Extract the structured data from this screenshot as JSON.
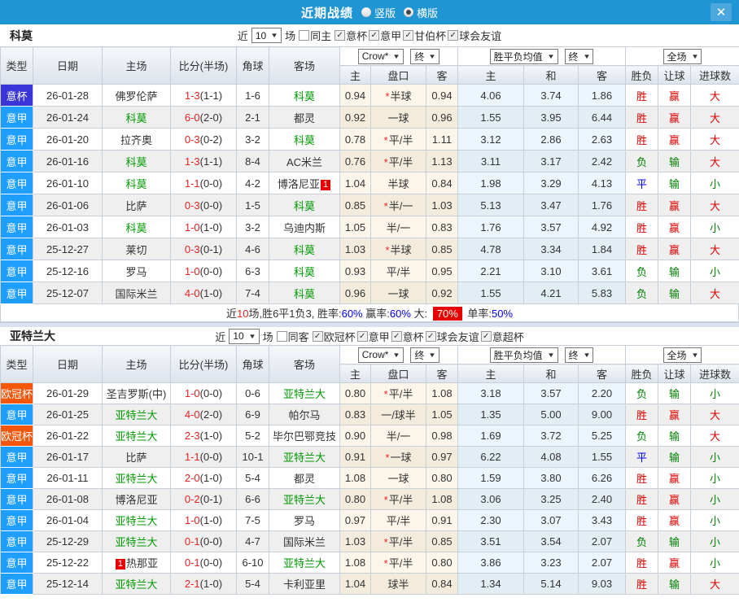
{
  "icons": {
    "close": "✕",
    "dropdown_arrow": "▼",
    "check": "✓"
  },
  "colors": {
    "topbar": "#2095D4",
    "league": {
      "意甲": "#1E9FFF",
      "意杯": "#3935D8",
      "欧冠杯": "#F4560A"
    },
    "result": {
      "胜": "#E00000",
      "平": "#0000E0",
      "负": "#008000",
      "赢": "#E00000",
      "输": "#008000",
      "大": "#E00000",
      "小": "#008000"
    }
  },
  "titlebar": {
    "title": "近期战绩",
    "radio_vertical": "竖版",
    "radio_horizontal": "横版",
    "selected_mode": "横版"
  },
  "table_header": {
    "type": "类型",
    "date": "日期",
    "home": "主场",
    "score": "比分(半场)",
    "corner": "角球",
    "away": "客场",
    "sub": [
      "主",
      "盘口",
      "客",
      "主",
      "和",
      "客",
      "胜负",
      "让球",
      "进球数"
    ],
    "select_company": "Crow*",
    "select_final1": "终",
    "select_avg": "胜平负均值",
    "select_final2": "终",
    "select_scope": "全场"
  },
  "sections": [
    {
      "team": "科莫",
      "filters": {
        "near": "近",
        "count": "10",
        "games": "场",
        "same": "同主",
        "same_checked": false,
        "leagues": [
          {
            "label": "意杯",
            "checked": true
          },
          {
            "label": "意甲",
            "checked": true
          },
          {
            "label": "甘伯杯",
            "checked": true
          },
          {
            "label": "球会友谊",
            "checked": true
          }
        ]
      },
      "rows": [
        {
          "league": "意杯",
          "date": "26-01-28",
          "home": {
            "name": "佛罗伦萨"
          },
          "ft": "1-3",
          "ht": "(1-1)",
          "corner": "1-6",
          "away": {
            "name": "科莫",
            "focus": true
          },
          "h1": "0.94",
          "star": true,
          "hcp": "半球",
          "h2": "0.94",
          "e1": "4.06",
          "e2": "3.74",
          "e3": "1.86",
          "r1": "胜",
          "r2": "赢",
          "r3": "大"
        },
        {
          "league": "意甲",
          "date": "26-01-24",
          "home": {
            "name": "科莫",
            "focus": true
          },
          "ft": "6-0",
          "ht": "(2-0)",
          "corner": "2-1",
          "away": {
            "name": "都灵"
          },
          "h1": "0.92",
          "star": false,
          "hcp": "一球",
          "h2": "0.96",
          "e1": "1.55",
          "e2": "3.95",
          "e3": "6.44",
          "r1": "胜",
          "r2": "赢",
          "r3": "大"
        },
        {
          "league": "意甲",
          "date": "26-01-20",
          "home": {
            "name": "拉齐奥"
          },
          "ft": "0-3",
          "ht": "(0-2)",
          "corner": "3-2",
          "away": {
            "name": "科莫",
            "focus": true
          },
          "h1": "0.78",
          "star": true,
          "hcp": "平/半",
          "h2": "1.11",
          "e1": "3.12",
          "e2": "2.86",
          "e3": "2.63",
          "r1": "胜",
          "r2": "赢",
          "r3": "大"
        },
        {
          "league": "意甲",
          "date": "26-01-16",
          "home": {
            "name": "科莫",
            "focus": true
          },
          "ft": "1-3",
          "ht": "(1-1)",
          "corner": "8-4",
          "away": {
            "name": "AC米兰"
          },
          "h1": "0.76",
          "star": true,
          "hcp": "平/半",
          "h2": "1.13",
          "e1": "3.11",
          "e2": "3.17",
          "e3": "2.42",
          "r1": "负",
          "r2": "输",
          "r3": "大"
        },
        {
          "league": "意甲",
          "date": "26-01-10",
          "home": {
            "name": "科莫",
            "focus": true
          },
          "ft": "1-1",
          "ht": "(0-0)",
          "corner": "4-2",
          "away": {
            "name": "博洛尼亚",
            "card_after": "1"
          },
          "h1": "1.04",
          "star": false,
          "hcp": "半球",
          "h2": "0.84",
          "e1": "1.98",
          "e2": "3.29",
          "e3": "4.13",
          "r1": "平",
          "r2": "输",
          "r3": "小"
        },
        {
          "league": "意甲",
          "date": "26-01-06",
          "home": {
            "name": "比萨"
          },
          "ft": "0-3",
          "ht": "(0-0)",
          "corner": "1-5",
          "away": {
            "name": "科莫",
            "focus": true
          },
          "h1": "0.85",
          "star": true,
          "hcp": "半/一",
          "h2": "1.03",
          "e1": "5.13",
          "e2": "3.47",
          "e3": "1.76",
          "r1": "胜",
          "r2": "赢",
          "r3": "大"
        },
        {
          "league": "意甲",
          "date": "26-01-03",
          "home": {
            "name": "科莫",
            "focus": true
          },
          "ft": "1-0",
          "ht": "(1-0)",
          "corner": "3-2",
          "away": {
            "name": "乌迪内斯"
          },
          "h1": "1.05",
          "star": false,
          "hcp": "半/一",
          "h2": "0.83",
          "e1": "1.76",
          "e2": "3.57",
          "e3": "4.92",
          "r1": "胜",
          "r2": "赢",
          "r3": "小"
        },
        {
          "league": "意甲",
          "date": "25-12-27",
          "home": {
            "name": "莱切"
          },
          "ft": "0-3",
          "ht": "(0-1)",
          "corner": "4-6",
          "away": {
            "name": "科莫",
            "focus": true
          },
          "h1": "1.03",
          "star": true,
          "hcp": "半球",
          "h2": "0.85",
          "e1": "4.78",
          "e2": "3.34",
          "e3": "1.84",
          "r1": "胜",
          "r2": "赢",
          "r3": "大"
        },
        {
          "league": "意甲",
          "date": "25-12-16",
          "home": {
            "name": "罗马"
          },
          "ft": "1-0",
          "ht": "(0-0)",
          "corner": "6-3",
          "away": {
            "name": "科莫",
            "focus": true
          },
          "h1": "0.93",
          "star": false,
          "hcp": "平/半",
          "h2": "0.95",
          "e1": "2.21",
          "e2": "3.10",
          "e3": "3.61",
          "r1": "负",
          "r2": "输",
          "r3": "小"
        },
        {
          "league": "意甲",
          "date": "25-12-07",
          "home": {
            "name": "国际米兰"
          },
          "ft": "4-0",
          "ht": "(1-0)",
          "corner": "7-4",
          "away": {
            "name": "科莫",
            "focus": true
          },
          "h1": "0.96",
          "star": false,
          "hcp": "一球",
          "h2": "0.92",
          "e1": "1.55",
          "e2": "4.21",
          "e3": "5.83",
          "r1": "负",
          "r2": "输",
          "r3": "大"
        }
      ],
      "summary": [
        {
          "t": "近"
        },
        {
          "t": "10",
          "c": "red"
        },
        {
          "t": "场,胜6平1负3, 胜率:"
        },
        {
          "t": "60%",
          "c": "blue"
        },
        {
          "t": " 赢率:"
        },
        {
          "t": "60%",
          "c": "blue"
        },
        {
          "t": " 大: "
        },
        {
          "t": "70%",
          "c": "redbg"
        },
        {
          "t": " 单率:"
        },
        {
          "t": "50%",
          "c": "blue"
        }
      ]
    },
    {
      "team": "亚特兰大",
      "filters": {
        "near": "近",
        "count": "10",
        "games": "场",
        "same": "同客",
        "same_checked": false,
        "leagues": [
          {
            "label": "欧冠杯",
            "checked": true
          },
          {
            "label": "意甲",
            "checked": true
          },
          {
            "label": "意杯",
            "checked": true
          },
          {
            "label": "球会友谊",
            "checked": true
          },
          {
            "label": "意超杯",
            "checked": true
          }
        ]
      },
      "rows": [
        {
          "league": "欧冠杯",
          "date": "26-01-29",
          "home": {
            "name": "圣吉罗斯(中)"
          },
          "ft": "1-0",
          "ht": "(0-0)",
          "corner": "0-6",
          "away": {
            "name": "亚特兰大",
            "focus": true
          },
          "h1": "0.80",
          "star": true,
          "hcp": "平/半",
          "h2": "1.08",
          "e1": "3.18",
          "e2": "3.57",
          "e3": "2.20",
          "r1": "负",
          "r2": "输",
          "r3": "小"
        },
        {
          "league": "意甲",
          "date": "26-01-25",
          "home": {
            "name": "亚特兰大",
            "focus": true
          },
          "ft": "4-0",
          "ht": "(2-0)",
          "corner": "6-9",
          "away": {
            "name": "帕尔马"
          },
          "h1": "0.83",
          "star": false,
          "hcp": "一/球半",
          "h2": "1.05",
          "e1": "1.35",
          "e2": "5.00",
          "e3": "9.00",
          "r1": "胜",
          "r2": "赢",
          "r3": "大"
        },
        {
          "league": "欧冠杯",
          "date": "26-01-22",
          "home": {
            "name": "亚特兰大",
            "focus": true
          },
          "ft": "2-3",
          "ht": "(1-0)",
          "corner": "5-2",
          "away": {
            "name": "毕尔巴鄂竞技"
          },
          "h1": "0.90",
          "star": false,
          "hcp": "半/一",
          "h2": "0.98",
          "e1": "1.69",
          "e2": "3.72",
          "e3": "5.25",
          "r1": "负",
          "r2": "输",
          "r3": "大"
        },
        {
          "league": "意甲",
          "date": "26-01-17",
          "home": {
            "name": "比萨"
          },
          "ft": "1-1",
          "ht": "(0-0)",
          "corner": "10-1",
          "away": {
            "name": "亚特兰大",
            "focus": true
          },
          "h1": "0.91",
          "star": true,
          "hcp": "一球",
          "h2": "0.97",
          "e1": "6.22",
          "e2": "4.08",
          "e3": "1.55",
          "r1": "平",
          "r2": "输",
          "r3": "小"
        },
        {
          "league": "意甲",
          "date": "26-01-11",
          "home": {
            "name": "亚特兰大",
            "focus": true
          },
          "ft": "2-0",
          "ht": "(1-0)",
          "corner": "5-4",
          "away": {
            "name": "都灵"
          },
          "h1": "1.08",
          "star": false,
          "hcp": "一球",
          "h2": "0.80",
          "e1": "1.59",
          "e2": "3.80",
          "e3": "6.26",
          "r1": "胜",
          "r2": "赢",
          "r3": "小"
        },
        {
          "league": "意甲",
          "date": "26-01-08",
          "home": {
            "name": "博洛尼亚"
          },
          "ft": "0-2",
          "ht": "(0-1)",
          "corner": "6-6",
          "away": {
            "name": "亚特兰大",
            "focus": true
          },
          "h1": "0.80",
          "star": true,
          "hcp": "平/半",
          "h2": "1.08",
          "e1": "3.06",
          "e2": "3.25",
          "e3": "2.40",
          "r1": "胜",
          "r2": "赢",
          "r3": "小"
        },
        {
          "league": "意甲",
          "date": "26-01-04",
          "home": {
            "name": "亚特兰大",
            "focus": true
          },
          "ft": "1-0",
          "ht": "(1-0)",
          "corner": "7-5",
          "away": {
            "name": "罗马"
          },
          "h1": "0.97",
          "star": false,
          "hcp": "平/半",
          "h2": "0.91",
          "e1": "2.30",
          "e2": "3.07",
          "e3": "3.43",
          "r1": "胜",
          "r2": "赢",
          "r3": "小"
        },
        {
          "league": "意甲",
          "date": "25-12-29",
          "home": {
            "name": "亚特兰大",
            "focus": true
          },
          "ft": "0-1",
          "ht": "(0-0)",
          "corner": "4-7",
          "away": {
            "name": "国际米兰"
          },
          "h1": "1.03",
          "star": true,
          "hcp": "平/半",
          "h2": "0.85",
          "e1": "3.51",
          "e2": "3.54",
          "e3": "2.07",
          "r1": "负",
          "r2": "输",
          "r3": "小"
        },
        {
          "league": "意甲",
          "date": "25-12-22",
          "home": {
            "name": "热那亚",
            "card_before": "1"
          },
          "ft": "0-1",
          "ht": "(0-0)",
          "corner": "6-10",
          "away": {
            "name": "亚特兰大",
            "focus": true
          },
          "h1": "1.08",
          "star": true,
          "hcp": "平/半",
          "h2": "0.80",
          "e1": "3.86",
          "e2": "3.23",
          "e3": "2.07",
          "r1": "胜",
          "r2": "赢",
          "r3": "小"
        },
        {
          "league": "意甲",
          "date": "25-12-14",
          "home": {
            "name": "亚特兰大",
            "focus": true
          },
          "ft": "2-1",
          "ht": "(1-0)",
          "corner": "5-4",
          "away": {
            "name": "卡利亚里"
          },
          "h1": "1.04",
          "star": false,
          "hcp": "球半",
          "h2": "0.84",
          "e1": "1.34",
          "e2": "5.14",
          "e3": "9.03",
          "r1": "胜",
          "r2": "输",
          "r3": "大"
        }
      ],
      "summary": []
    }
  ]
}
